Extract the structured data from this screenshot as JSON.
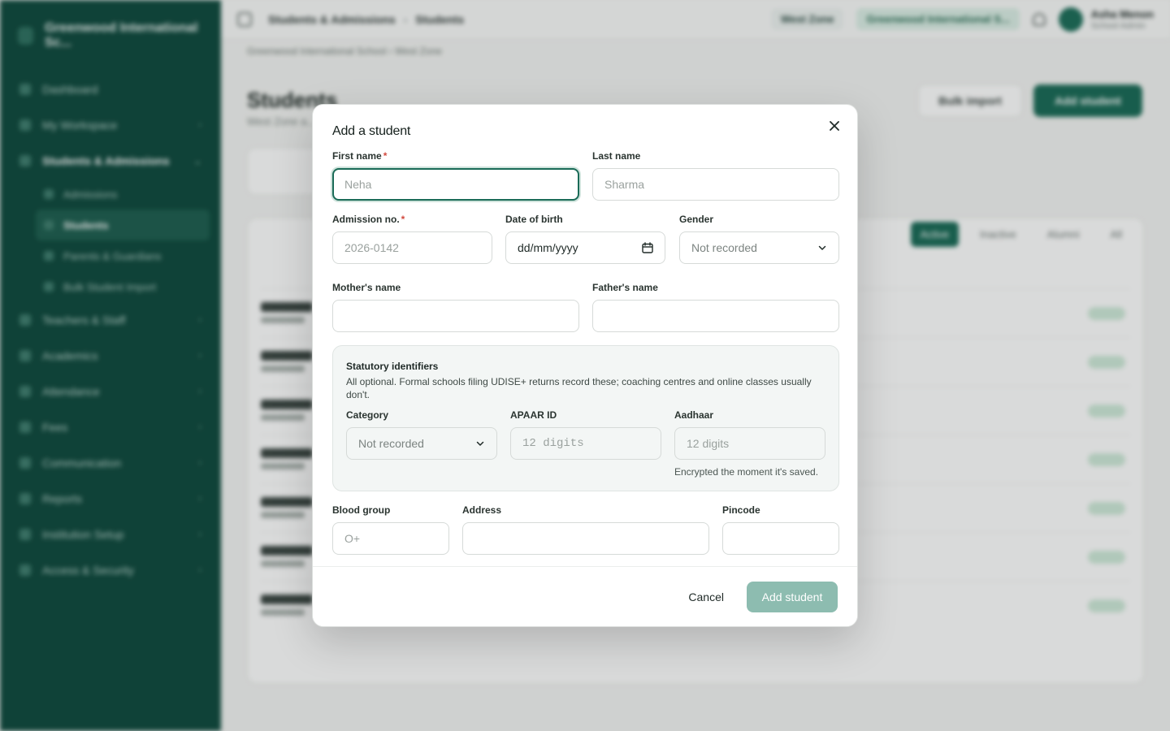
{
  "background": {
    "sidebar": {
      "org_name": "Greenwood International Sc...",
      "items": [
        {
          "label": "Dashboard"
        },
        {
          "label": "My Workspace"
        },
        {
          "label": "Students & Admissions"
        },
        {
          "label": "Teachers & Staff"
        },
        {
          "label": "Academics"
        },
        {
          "label": "Attendance"
        },
        {
          "label": "Fees"
        },
        {
          "label": "Communication"
        },
        {
          "label": "Reports"
        },
        {
          "label": "Institution Setup"
        },
        {
          "label": "Access & Security"
        }
      ],
      "sub_items": [
        {
          "label": "Admissions"
        },
        {
          "label": "Students"
        },
        {
          "label": "Parents & Guardians"
        },
        {
          "label": "Bulk Student Import"
        }
      ]
    },
    "topbar": {
      "crumb_parent": "Students & Admissions",
      "crumb_current": "Students",
      "zone": "West Zone",
      "school": "Greenwood International S...",
      "user_name": "Asha Menon",
      "user_role": "School Admin"
    },
    "subcrumb": "Greenwood International School  ›  West Zone",
    "page_title": "Students",
    "page_sub": "West Zone a...",
    "bulk_import": "Bulk import",
    "add_student": "Add student",
    "filters": [
      "Active",
      "Inactive",
      "Alumni",
      "All"
    ]
  },
  "modal": {
    "title": "Add a student",
    "first_name": {
      "label": "First name",
      "placeholder": "Neha"
    },
    "last_name": {
      "label": "Last name",
      "placeholder": "Sharma"
    },
    "admission_no": {
      "label": "Admission no.",
      "placeholder": "2026-0142"
    },
    "dob": {
      "label": "Date of birth",
      "value": "dd/mm/yyyy"
    },
    "gender": {
      "label": "Gender",
      "value": "Not recorded"
    },
    "mother_name": {
      "label": "Mother's name",
      "placeholder": ""
    },
    "father_name": {
      "label": "Father's name",
      "placeholder": ""
    },
    "required_mark": "*",
    "statutory": {
      "title": "Statutory identifiers",
      "description": "All optional. Formal schools filing UDISE+ returns record these; coaching centres and online classes usually don't.",
      "category": {
        "label": "Category",
        "value": "Not recorded"
      },
      "apaar": {
        "label": "APAAR ID",
        "placeholder": "12 digits"
      },
      "aadhaar": {
        "label": "Aadhaar",
        "placeholder": "12 digits",
        "hint": "Encrypted the moment it's saved."
      }
    },
    "blood_group": {
      "label": "Blood group",
      "placeholder": "O+"
    },
    "address": {
      "label": "Address",
      "placeholder": ""
    },
    "pincode": {
      "label": "Pincode",
      "placeholder": ""
    },
    "cancel_label": "Cancel",
    "submit_label": "Add student"
  },
  "colors": {
    "accent": "#1a6b57",
    "submit_disabled": "#8dbcb0",
    "sidebar_bg": "#0f4a3e",
    "required": "#d24a3f"
  },
  "icons": [
    "close-icon",
    "chevron-down-icon",
    "calendar-icon"
  ]
}
